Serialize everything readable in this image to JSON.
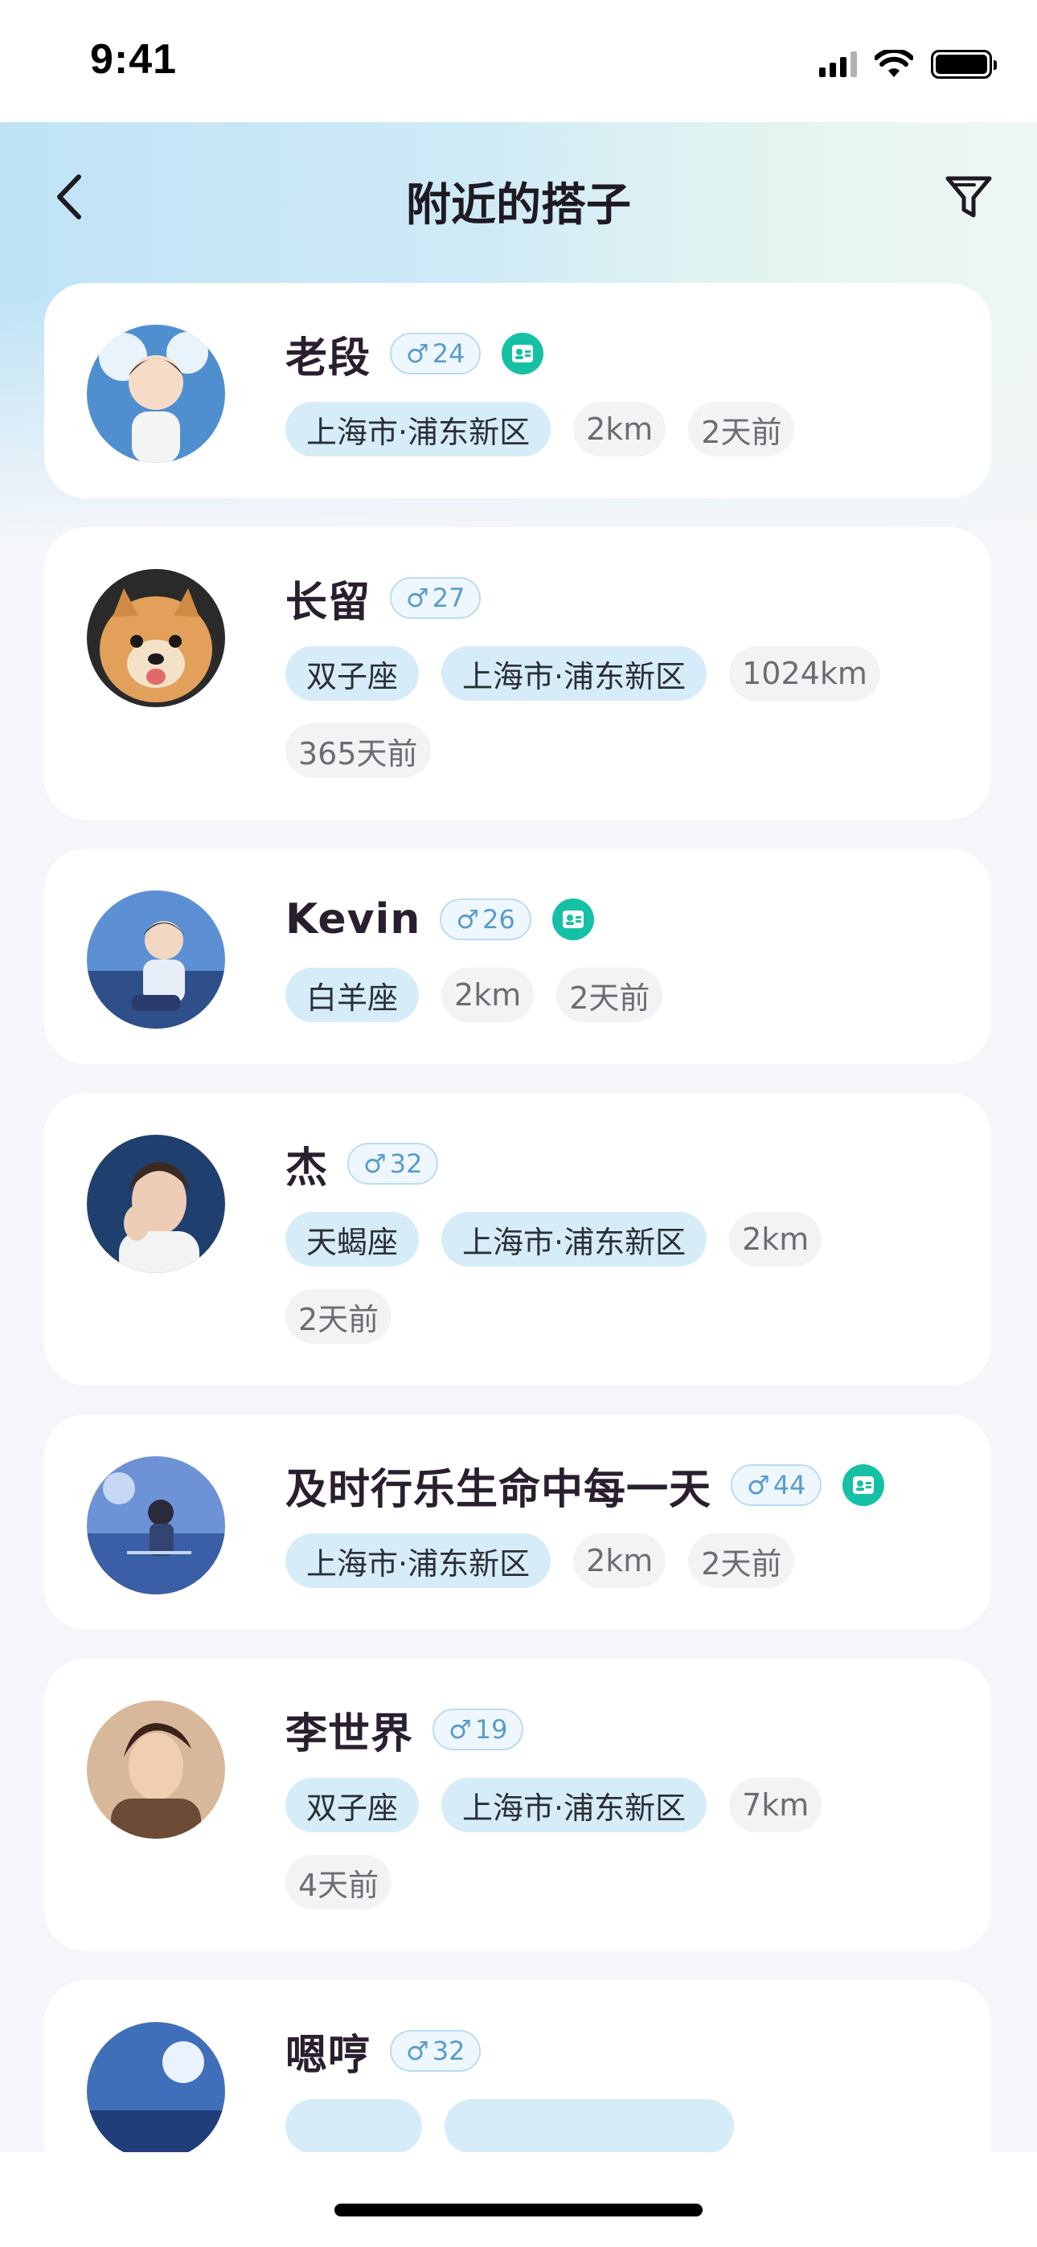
{
  "status_bar": {
    "time": "9:41"
  },
  "nav": {
    "title": "附近的搭子"
  },
  "users": [
    {
      "name": "老段",
      "gender": "♂",
      "age": "24",
      "verified": true,
      "tags": [
        {
          "text": "上海市·浦东新区",
          "style": "blue"
        },
        {
          "text": "2km",
          "style": "gray"
        },
        {
          "text": "2天前",
          "style": "gray"
        }
      ]
    },
    {
      "name": "长留",
      "gender": "♂",
      "age": "27",
      "verified": false,
      "tags": [
        {
          "text": "双子座",
          "style": "blue"
        },
        {
          "text": "上海市·浦东新区",
          "style": "blue"
        },
        {
          "text": "1024km",
          "style": "gray"
        },
        {
          "text": "365天前",
          "style": "gray"
        }
      ]
    },
    {
      "name": "Kevin",
      "gender": "♂",
      "age": "26",
      "verified": true,
      "tags": [
        {
          "text": "白羊座",
          "style": "blue"
        },
        {
          "text": "2km",
          "style": "gray"
        },
        {
          "text": "2天前",
          "style": "gray"
        }
      ]
    },
    {
      "name": "杰",
      "gender": "♂",
      "age": "32",
      "verified": false,
      "tags": [
        {
          "text": "天蝎座",
          "style": "blue"
        },
        {
          "text": "上海市·浦东新区",
          "style": "blue"
        },
        {
          "text": "2km",
          "style": "gray"
        },
        {
          "text": "2天前",
          "style": "gray"
        }
      ]
    },
    {
      "name": "及时行乐生命中每一天",
      "gender": "♂",
      "age": "44",
      "verified": true,
      "tags": [
        {
          "text": "上海市·浦东新区",
          "style": "blue"
        },
        {
          "text": "2km",
          "style": "gray"
        },
        {
          "text": "2天前",
          "style": "gray"
        }
      ]
    },
    {
      "name": "李世界",
      "gender": "♂",
      "age": "19",
      "verified": false,
      "tags": [
        {
          "text": "双子座",
          "style": "blue"
        },
        {
          "text": "上海市·浦东新区",
          "style": "blue"
        },
        {
          "text": "7km",
          "style": "gray"
        },
        {
          "text": "4天前",
          "style": "gray"
        }
      ]
    },
    {
      "name": "嗯哼",
      "gender": "♂",
      "age": "32",
      "verified": false,
      "tags": [
        {
          "text": "",
          "style": "blue"
        },
        {
          "text": "",
          "style": "blue"
        }
      ]
    }
  ],
  "colors": {
    "accent_blue": "#5a9ccc",
    "verify_green": "#16c0a4",
    "tag_blue_bg": "#d6ecf8"
  }
}
